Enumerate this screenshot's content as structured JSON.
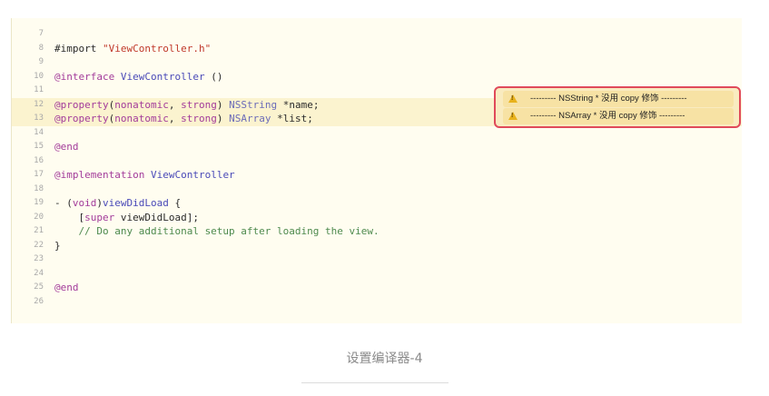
{
  "editor": {
    "lines": [
      {
        "num": "7",
        "segs": []
      },
      {
        "num": "8",
        "segs": [
          {
            "t": "#import ",
            "c": ""
          },
          {
            "t": "\"ViewController.h\"",
            "c": "s"
          }
        ]
      },
      {
        "num": "9",
        "segs": []
      },
      {
        "num": "10",
        "segs": [
          {
            "t": "@interface ",
            "c": "k"
          },
          {
            "t": "ViewController",
            "c": "t"
          },
          {
            "t": " ()",
            "c": ""
          }
        ]
      },
      {
        "num": "11",
        "segs": []
      },
      {
        "num": "12",
        "hl": true,
        "segs": [
          {
            "t": "@property",
            "c": "k"
          },
          {
            "t": "(",
            "c": ""
          },
          {
            "t": "nonatomic",
            "c": "k"
          },
          {
            "t": ", ",
            "c": ""
          },
          {
            "t": "strong",
            "c": "k"
          },
          {
            "t": ") ",
            "c": ""
          },
          {
            "t": "NSString",
            "c": "p"
          },
          {
            "t": " *name;",
            "c": ""
          }
        ]
      },
      {
        "num": "13",
        "hl": true,
        "segs": [
          {
            "t": "@property",
            "c": "k"
          },
          {
            "t": "(",
            "c": ""
          },
          {
            "t": "nonatomic",
            "c": "k"
          },
          {
            "t": ", ",
            "c": ""
          },
          {
            "t": "strong",
            "c": "k"
          },
          {
            "t": ") ",
            "c": ""
          },
          {
            "t": "NSArray",
            "c": "p"
          },
          {
            "t": " *list;",
            "c": ""
          }
        ]
      },
      {
        "num": "14",
        "segs": []
      },
      {
        "num": "15",
        "segs": [
          {
            "t": "@end",
            "c": "k"
          }
        ]
      },
      {
        "num": "16",
        "segs": []
      },
      {
        "num": "17",
        "segs": [
          {
            "t": "@implementation ",
            "c": "k"
          },
          {
            "t": "ViewController",
            "c": "t"
          }
        ]
      },
      {
        "num": "18",
        "segs": []
      },
      {
        "num": "19",
        "segs": [
          {
            "t": "- (",
            "c": ""
          },
          {
            "t": "void",
            "c": "k"
          },
          {
            "t": ")",
            "c": ""
          },
          {
            "t": "viewDidLoad",
            "c": "t"
          },
          {
            "t": " {",
            "c": ""
          }
        ]
      },
      {
        "num": "20",
        "segs": [
          {
            "t": "    [",
            "c": ""
          },
          {
            "t": "super",
            "c": "k"
          },
          {
            "t": " viewDidLoad];",
            "c": ""
          }
        ]
      },
      {
        "num": "21",
        "segs": [
          {
            "t": "    // Do any additional setup after loading the view.",
            "c": "c"
          }
        ]
      },
      {
        "num": "22",
        "segs": [
          {
            "t": "}",
            "c": ""
          }
        ]
      },
      {
        "num": "23",
        "segs": []
      },
      {
        "num": "24",
        "segs": []
      },
      {
        "num": "25",
        "segs": [
          {
            "t": "@end",
            "c": "k"
          }
        ]
      },
      {
        "num": "26",
        "segs": []
      }
    ]
  },
  "warnings": [
    {
      "text": "--------- NSString * 没用 copy 修饰 ---------",
      "icon": "warning-triangle-icon"
    },
    {
      "text": "--------- NSArray * 没用 copy 修饰 ---------",
      "icon": "warning-triangle-icon"
    }
  ],
  "caption": "设置编译器-4",
  "colors": {
    "keyword": "#a33c9a",
    "type": "#4a4ab8",
    "string": "#c0392b",
    "comment": "#4e8a4e",
    "highlight_box": "#e04a5a",
    "warning_icon": "#e8b21c"
  }
}
